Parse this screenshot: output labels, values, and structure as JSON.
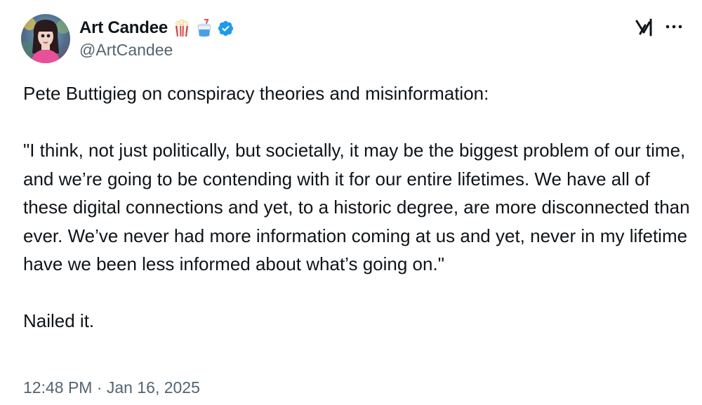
{
  "author": {
    "display_name": "Art Candee",
    "handle": "@ArtCandee",
    "verified": true,
    "emojis": [
      "popcorn-icon",
      "soda-cup-icon"
    ]
  },
  "tweet": {
    "intro": "Pete Buttigieg on conspiracy theories and misinformation:",
    "quote": "\"I think, not just politically, but societally, it may be the biggest problem of our time, and we’re going to be contending with it for our entire lifetimes. We have all of these digital connections and yet, to a historic degree, are more disconnected than ever. We’ve never had more information coming at us and yet, never in my lifetime have we been less informed about what’s going on.\"",
    "closing": "Nailed it.",
    "timestamp": "12:48 PM · Jan 16, 2025"
  },
  "colors": {
    "text": "#0f1419",
    "secondary": "#536471",
    "verified_blue": "#1d9bf0"
  }
}
